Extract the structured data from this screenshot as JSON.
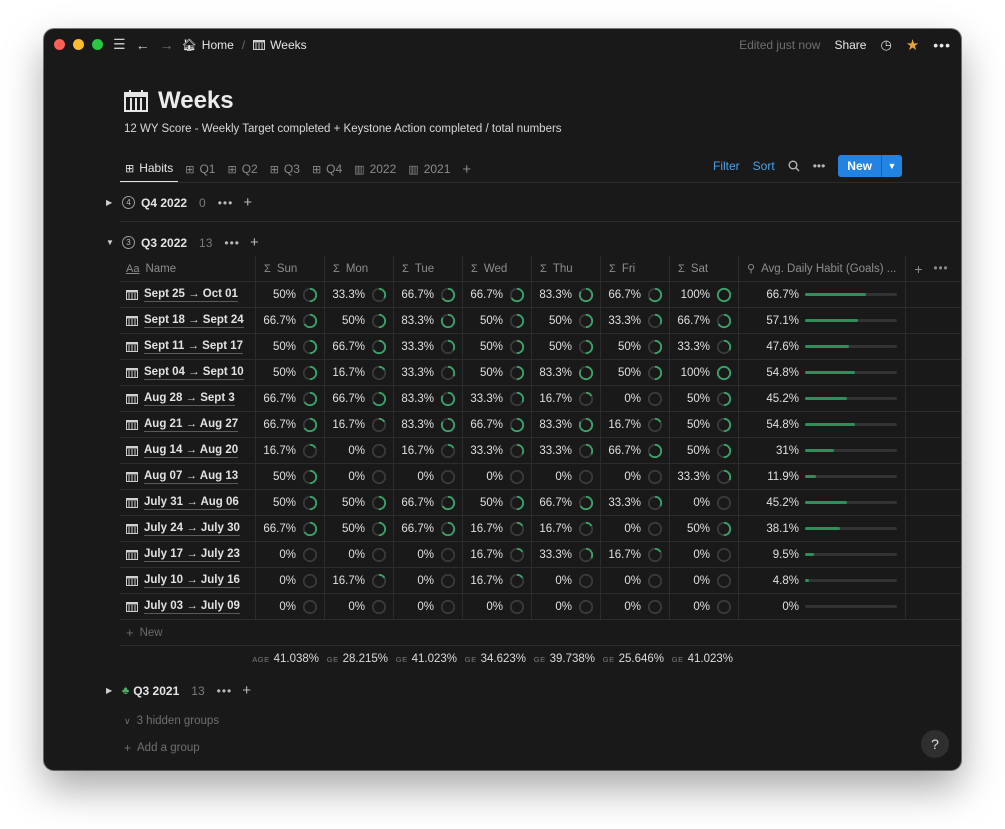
{
  "topbar": {
    "crumbs": [
      "Home",
      "Weeks"
    ],
    "edited": "Edited just now",
    "share": "Share"
  },
  "page": {
    "title": "Weeks",
    "description": "12 WY Score - Weekly Target completed + Keystone Action completed  / total numbers"
  },
  "tabs": [
    {
      "label": "Habits",
      "icon": "table-icon",
      "active": true
    },
    {
      "label": "Q1",
      "icon": "table-icon"
    },
    {
      "label": "Q2",
      "icon": "table-icon"
    },
    {
      "label": "Q3",
      "icon": "table-icon"
    },
    {
      "label": "Q4",
      "icon": "table-icon"
    },
    {
      "label": "2022",
      "icon": "board-icon"
    },
    {
      "label": "2021",
      "icon": "board-icon"
    }
  ],
  "toolbar": {
    "filter": "Filter",
    "sort": "Sort",
    "new": "New"
  },
  "groups": {
    "q4_2022": {
      "num": "4",
      "name": "Q4 2022",
      "count": "0"
    },
    "q3_2022": {
      "num": "3",
      "name": "Q3 2022",
      "count": "13"
    },
    "q3_2021": {
      "name": "Q3 2021",
      "count": "13"
    },
    "hidden": "3 hidden groups",
    "add": "Add a group"
  },
  "table": {
    "columns": {
      "name": "Name",
      "days": [
        "Sun",
        "Mon",
        "Tue",
        "Wed",
        "Thu",
        "Fri",
        "Sat"
      ],
      "avg": "Avg. Daily Habit (Goals) ..."
    },
    "rows": [
      {
        "name": "Sept 25 → Oct 01",
        "days": [
          "50%",
          "33.3%",
          "66.7%",
          "66.7%",
          "83.3%",
          "66.7%",
          "100%"
        ],
        "avg": "66.7%",
        "avg_value": 0.667
      },
      {
        "name": "Sept 18 → Sept 24",
        "days": [
          "66.7%",
          "50%",
          "83.3%",
          "50%",
          "50%",
          "33.3%",
          "66.7%"
        ],
        "avg": "57.1%",
        "avg_value": 0.571
      },
      {
        "name": "Sept 11 → Sept 17",
        "days": [
          "50%",
          "66.7%",
          "33.3%",
          "50%",
          "50%",
          "50%",
          "33.3%"
        ],
        "avg": "47.6%",
        "avg_value": 0.476
      },
      {
        "name": "Sept 04 → Sept 10",
        "days": [
          "50%",
          "16.7%",
          "33.3%",
          "50%",
          "83.3%",
          "50%",
          "100%"
        ],
        "avg": "54.8%",
        "avg_value": 0.548
      },
      {
        "name": "Aug 28 → Sept 3",
        "days": [
          "66.7%",
          "66.7%",
          "83.3%",
          "33.3%",
          "16.7%",
          "0%",
          "50%"
        ],
        "avg": "45.2%",
        "avg_value": 0.452
      },
      {
        "name": "Aug 21 → Aug 27",
        "days": [
          "66.7%",
          "16.7%",
          "83.3%",
          "66.7%",
          "83.3%",
          "16.7%",
          "50%"
        ],
        "avg": "54.8%",
        "avg_value": 0.548
      },
      {
        "name": "Aug 14 → Aug 20",
        "days": [
          "16.7%",
          "0%",
          "16.7%",
          "33.3%",
          "33.3%",
          "66.7%",
          "50%"
        ],
        "avg": "31%",
        "avg_value": 0.31
      },
      {
        "name": "Aug 07 → Aug 13",
        "days": [
          "50%",
          "0%",
          "0%",
          "0%",
          "0%",
          "0%",
          "33.3%"
        ],
        "avg": "11.9%",
        "avg_value": 0.119
      },
      {
        "name": "July 31 → Aug 06",
        "days": [
          "50%",
          "50%",
          "66.7%",
          "50%",
          "66.7%",
          "33.3%",
          "0%"
        ],
        "avg": "45.2%",
        "avg_value": 0.452
      },
      {
        "name": "July 24 → July 30",
        "days": [
          "66.7%",
          "50%",
          "66.7%",
          "16.7%",
          "16.7%",
          "0%",
          "50%"
        ],
        "avg": "38.1%",
        "avg_value": 0.381
      },
      {
        "name": "July 17 → July 23",
        "days": [
          "0%",
          "0%",
          "0%",
          "16.7%",
          "33.3%",
          "16.7%",
          "0%"
        ],
        "avg": "9.5%",
        "avg_value": 0.095
      },
      {
        "name": "July 10 → July 16",
        "days": [
          "0%",
          "16.7%",
          "0%",
          "16.7%",
          "0%",
          "0%",
          "0%"
        ],
        "avg": "4.8%",
        "avg_value": 0.048
      },
      {
        "name": "July 03 → July 09",
        "days": [
          "0%",
          "0%",
          "0%",
          "0%",
          "0%",
          "0%",
          "0%"
        ],
        "avg": "0%",
        "avg_value": 0
      }
    ],
    "new_row": "New",
    "calc_first_label": "AGE",
    "calc_label": "GE",
    "calcs": [
      "41.038%",
      "28.215%",
      "41.023%",
      "34.623%",
      "39.738%",
      "25.646%",
      "41.023%"
    ]
  },
  "help": "?"
}
